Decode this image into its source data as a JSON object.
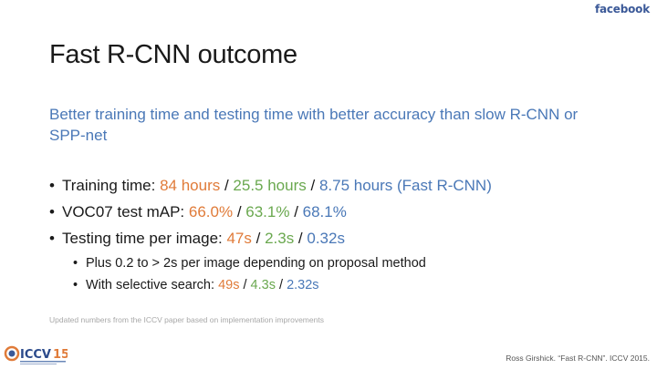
{
  "brand": "facebook",
  "slide": {
    "title": "Fast R-CNN outcome",
    "subtitle": "Better training time and testing time with better accuracy than slow R-CNN or SPP-net",
    "bullets": {
      "training": {
        "label": "Training time: ",
        "v1": "84 hours",
        "sep1": " / ",
        "v2": "25.5 hours",
        "sep2": " / ",
        "v3": "8.75 hours (Fast R-CNN)"
      },
      "voc": {
        "label": "VOC07 test mAP: ",
        "v1": "66.0%",
        "sep1": " / ",
        "v2": "63.1%",
        "sep2": " / ",
        "v3": "68.1%"
      },
      "testing": {
        "label": "Testing time per image: ",
        "v1": "47s",
        "sep1": " / ",
        "v2": "2.3s",
        "sep2": " / ",
        "v3": "0.32s"
      },
      "sub1": "Plus 0.2 to > 2s per image depending on proposal method",
      "sub2": {
        "label": "With selective search: ",
        "v1": "49s",
        "sep1": " / ",
        "v2": "4.3s",
        "sep2": " / ",
        "v3": "2.32s"
      }
    },
    "footnote": "Updated numbers from the ICCV paper based on implementation improvements",
    "conference_logo": "ICCV15",
    "citation": "Ross Girshick. “Fast R-CNN”. ICCV 2015."
  },
  "colors": {
    "orange": "#e07b39",
    "green": "#6aa84f",
    "blue": "#4a78b7",
    "brand": "#3b5998"
  }
}
